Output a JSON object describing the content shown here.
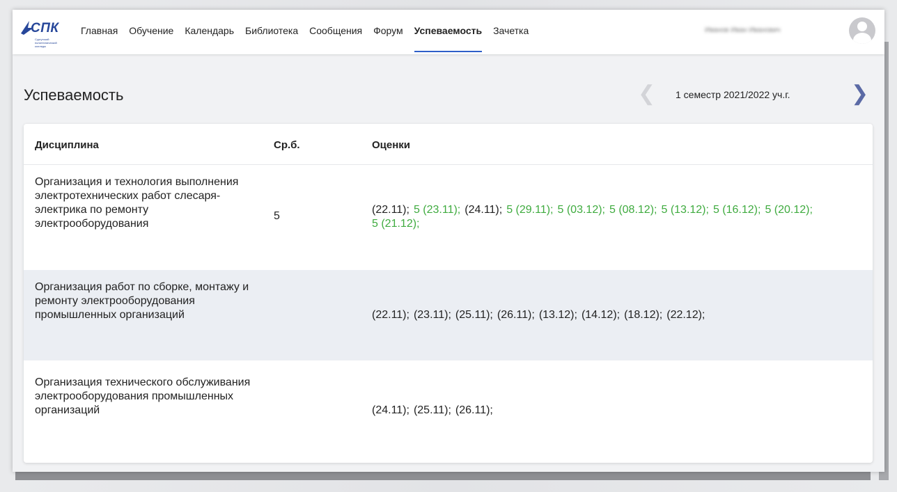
{
  "logo": {
    "text": "СПК",
    "subtitle": "Сургутский политехнический колледж"
  },
  "nav": {
    "items": [
      {
        "label": "Главная",
        "active": false
      },
      {
        "label": "Обучение",
        "active": false
      },
      {
        "label": "Календарь",
        "active": false
      },
      {
        "label": "Библиотека",
        "active": false
      },
      {
        "label": "Сообщения",
        "active": false
      },
      {
        "label": "Форум",
        "active": false
      },
      {
        "label": "Успеваемость",
        "active": true
      },
      {
        "label": "Зачетка",
        "active": false
      }
    ],
    "user_name": "Иванов Иван Иванович",
    "avatar_icon": "user-avatar-icon"
  },
  "page": {
    "title": "Успеваемость",
    "semester": "1 семестр 2021/2022 уч.г.",
    "prev_icon": "chevron-left-icon",
    "next_icon": "chevron-right-icon"
  },
  "table": {
    "columns": [
      "Дисциплина",
      "Ср.б.",
      "Оценки"
    ],
    "rows": [
      {
        "discipline": "Организация и технология выполнения электротехнических работ слесаря-электрика по ремонту электрооборудования",
        "avg": "5",
        "grades": [
          {
            "text": "(22.11);",
            "mark": false
          },
          {
            "text": "5 (23.11);",
            "mark": true
          },
          {
            "text": "(24.11);",
            "mark": false
          },
          {
            "text": "5 (29.11);",
            "mark": true
          },
          {
            "text": "5 (03.12);",
            "mark": true
          },
          {
            "text": "5 (08.12);",
            "mark": true
          },
          {
            "text": "5 (13.12);",
            "mark": true
          },
          {
            "text": "5 (16.12);",
            "mark": true
          },
          {
            "text": "5 (20.12);",
            "mark": true
          },
          {
            "text": "5 (21.12);",
            "mark": true
          }
        ]
      },
      {
        "discipline": "Организация работ по сборке, монтажу и ремонту электрооборудования промышленных организаций",
        "avg": "",
        "grades": [
          {
            "text": "(22.11);",
            "mark": false
          },
          {
            "text": "(23.11);",
            "mark": false
          },
          {
            "text": "(25.11);",
            "mark": false
          },
          {
            "text": "(26.11);",
            "mark": false
          },
          {
            "text": "(13.12);",
            "mark": false
          },
          {
            "text": "(14.12);",
            "mark": false
          },
          {
            "text": "(18.12);",
            "mark": false
          },
          {
            "text": "(22.12);",
            "mark": false
          }
        ]
      },
      {
        "discipline": "Организация технического обслуживания электрооборудования промышленных организаций",
        "avg": "",
        "grades": [
          {
            "text": "(24.11);",
            "mark": false
          },
          {
            "text": "(25.11);",
            "mark": false
          },
          {
            "text": "(26.11);",
            "mark": false
          }
        ]
      }
    ]
  },
  "colors": {
    "accent": "#2f5fc8",
    "mark": "#3fab3f",
    "logo": "#27479a",
    "alt_row": "#ebeef3"
  }
}
